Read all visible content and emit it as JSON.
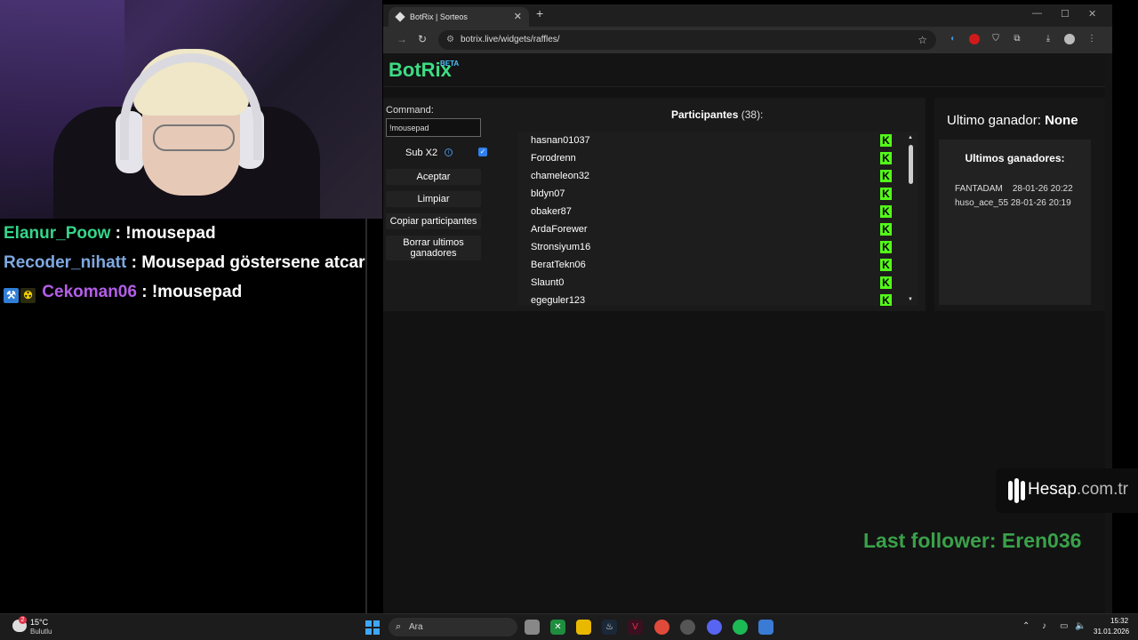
{
  "chat": [
    {
      "user": "Elanur_Poow",
      "sep": " : ",
      "message": "!mousepad",
      "color": "#35d58a"
    },
    {
      "user": "Recoder_nihatt",
      "sep": " : ",
      "message": "Mousepad göstersene atcar",
      "color": "#7fa8e0"
    },
    {
      "user": "Cekoman06",
      "sep": " : ",
      "message": "!mousepad",
      "color": "#b45ee8"
    }
  ],
  "browser": {
    "tab_title": "BotRix | Sorteos",
    "url": "botrix.live/widgets/raffles/"
  },
  "app": {
    "brand": "BotRix",
    "beta": "BETA",
    "command_label": "Command:",
    "command_value": "!mousepad",
    "sub_x2_label": "Sub X2",
    "sub_x2_checked": true,
    "buttons": {
      "accept": "Aceptar",
      "clear": "Limpiar",
      "copy": "Copiar participantes",
      "clear_winners": "Borrar ultimos ganadores"
    },
    "participants_title": "Participantes",
    "participants_count": "(38):",
    "participants": [
      "hasnan01037",
      "Forodrenn",
      "chameleon32",
      "bldyn07",
      "obaker87",
      "ArdaForewer",
      "Stronsiyum16",
      "BeratTekn06",
      "Slaunt0",
      "egeguler123"
    ],
    "last_winner_label": "Ultimo ganador:",
    "last_winner_value": "None",
    "recent_title": "Ultimos ganadores:",
    "recent_winners": [
      {
        "name": "FANTADAM",
        "date": "28-01-26 20:22"
      },
      {
        "name": "huso_ace_55",
        "date": "28-01-26 20:19"
      }
    ]
  },
  "overlay": {
    "sponsor_main": "Hesap",
    "sponsor_tld": ".com.tr",
    "last_follower": "Last follower: Eren036"
  },
  "taskbar": {
    "weather_badge": "2",
    "temperature": "15°C",
    "condition": "Bulutlu",
    "search_placeholder": "Ara",
    "time": "15:32",
    "date": "31.01.2026"
  },
  "colors": {
    "brand": "#3ddc84",
    "kick": "#53fc18",
    "follower": "#3aa14a"
  }
}
